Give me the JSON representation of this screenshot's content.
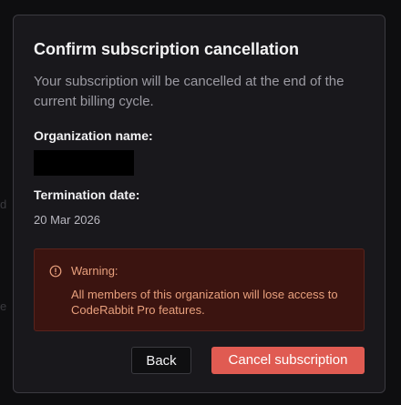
{
  "background": {
    "ghost_1": "d",
    "ghost_2": "e"
  },
  "dialog": {
    "title": "Confirm subscription cancellation",
    "description": "Your subscription will be cancelled at the end of the current billing cycle.",
    "organization_label": "Organization name:",
    "termination_label": "Termination date:",
    "termination_date": "20 Mar 2026",
    "warning": {
      "icon": "alert-circle-icon",
      "title": "Warning:",
      "text": "All members of this organization will lose access to CodeRabbit Pro features."
    },
    "actions": {
      "back_label": "Back",
      "cancel_label": "Cancel subscription"
    }
  },
  "colors": {
    "accent_danger": "#e05b52",
    "warning_bg": "#3b1410",
    "warning_text": "#e8a07d",
    "dialog_bg": "#19181c"
  }
}
